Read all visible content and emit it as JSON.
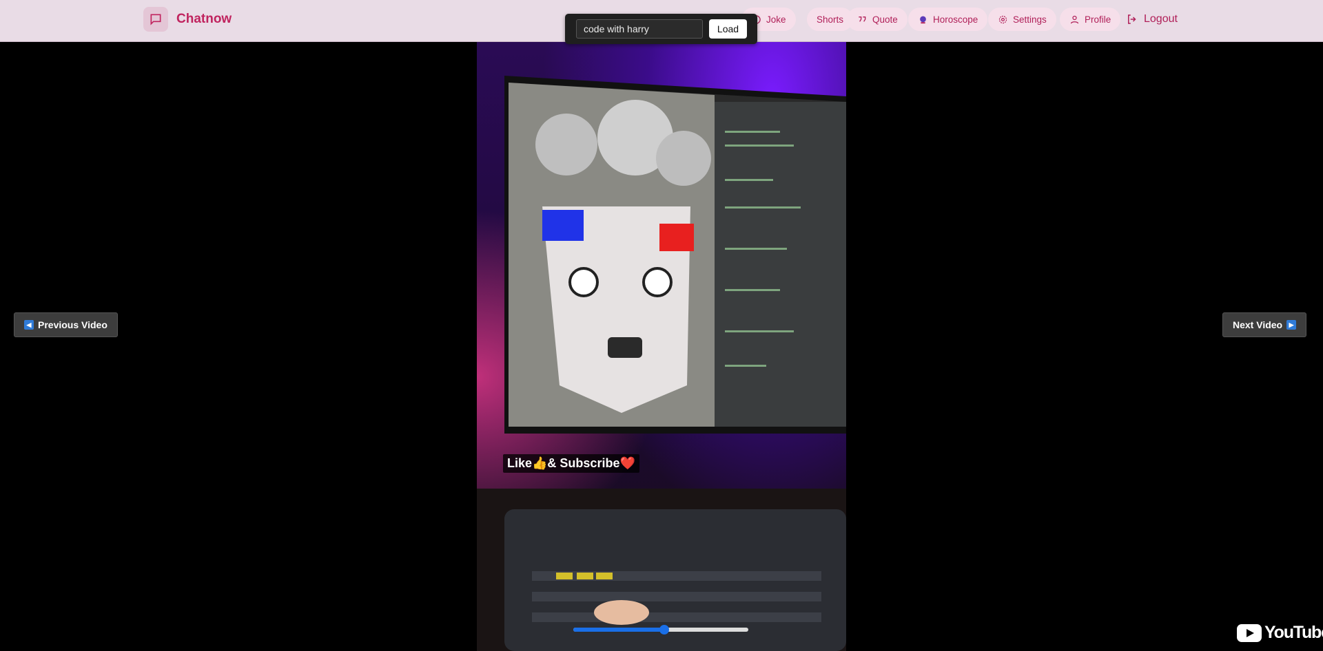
{
  "brand": {
    "name": "Chatnow"
  },
  "nav": {
    "items": [
      {
        "label": "Joke",
        "icon": "smile-icon"
      },
      {
        "label": "Shorts",
        "icon": "none"
      },
      {
        "label": "Quote",
        "icon": "quote-icon"
      },
      {
        "label": "Horoscope",
        "icon": "crystal-ball-icon"
      },
      {
        "label": "Settings",
        "icon": "gear-icon"
      },
      {
        "label": "Profile",
        "icon": "user-icon"
      }
    ],
    "logout_label": "Logout"
  },
  "loader": {
    "search_value": "code with harry",
    "load_label": "Load"
  },
  "player": {
    "prev_label": "Previous Video",
    "next_label": "Next Video",
    "overlay_text": "Like👍& Subscribe❤️",
    "progress_percent": 52,
    "watermark": "YouTube"
  },
  "colors": {
    "accent": "#c0245f",
    "topbar": "#e9dce6",
    "pill": "#f6dfea",
    "progress": "#1a6fe8"
  }
}
